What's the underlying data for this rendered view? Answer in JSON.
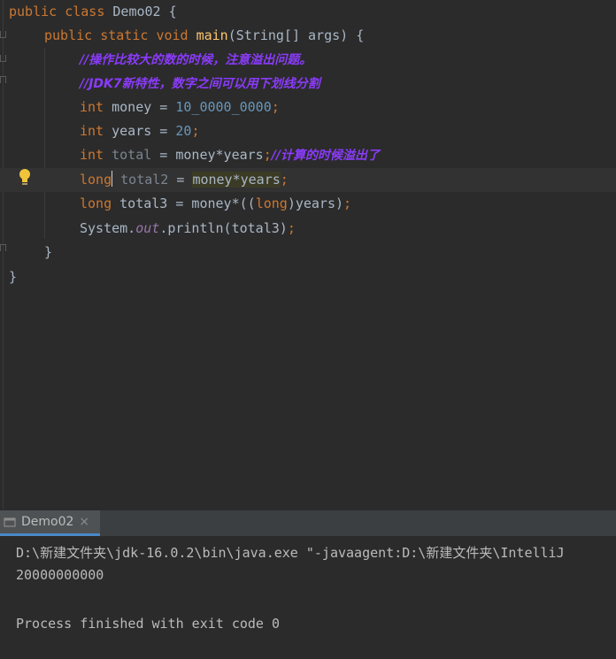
{
  "editor": {
    "lines": {
      "l1": {
        "kw1": "public",
        "kw2": "class",
        "rest": " Demo02 {"
      },
      "l2": {
        "kw1": "public",
        "kw2": "static",
        "kw3": "void",
        "fn": "main",
        "rest": "(String[] args) {"
      },
      "l3": {
        "comment": "//操作比较大的数的时候，注意溢出问题。"
      },
      "l4": {
        "comment": "//JDK7新特性，数字之间可以用下划线分割"
      },
      "l5": {
        "type": "int",
        "name": " money = ",
        "num": "10_0000_0000",
        "end": ";"
      },
      "l6": {
        "type": "int",
        "name": " years = ",
        "num": "20",
        "end": ";"
      },
      "l7": {
        "type": "int",
        "name": "total",
        "mid": " = money*years",
        "end": ";",
        "comment": "//计算的时候溢出了"
      },
      "l8": {
        "type": "long",
        "name": "total2",
        "mid": " = ",
        "expr": "money*years",
        "end": ";"
      },
      "l9": {
        "type": "long",
        "pre": " total3 = money*((",
        "cast": "long",
        "post": ")years)",
        "end": ";"
      },
      "l10": {
        "pre": "System.",
        "field": "out",
        "post": ".println(total3)",
        "end": ";"
      },
      "l11": {
        "text": "}"
      },
      "l12": {
        "text": "}"
      }
    }
  },
  "run_panel": {
    "tab_label": "Demo02",
    "tab_close": "×",
    "output": [
      "D:\\新建文件夹\\jdk-16.0.2\\bin\\java.exe \"-javaagent:D:\\新建文件夹\\IntelliJ",
      "20000000000",
      "",
      "Process finished with exit code 0"
    ]
  },
  "colors": {
    "keyword": "#cc7832",
    "method": "#ffc66d",
    "number": "#6897bb",
    "comment": "#8a3bfa",
    "field": "#9876aa"
  },
  "icons": {
    "bulb": "lightbulb-icon",
    "close": "close-icon"
  }
}
